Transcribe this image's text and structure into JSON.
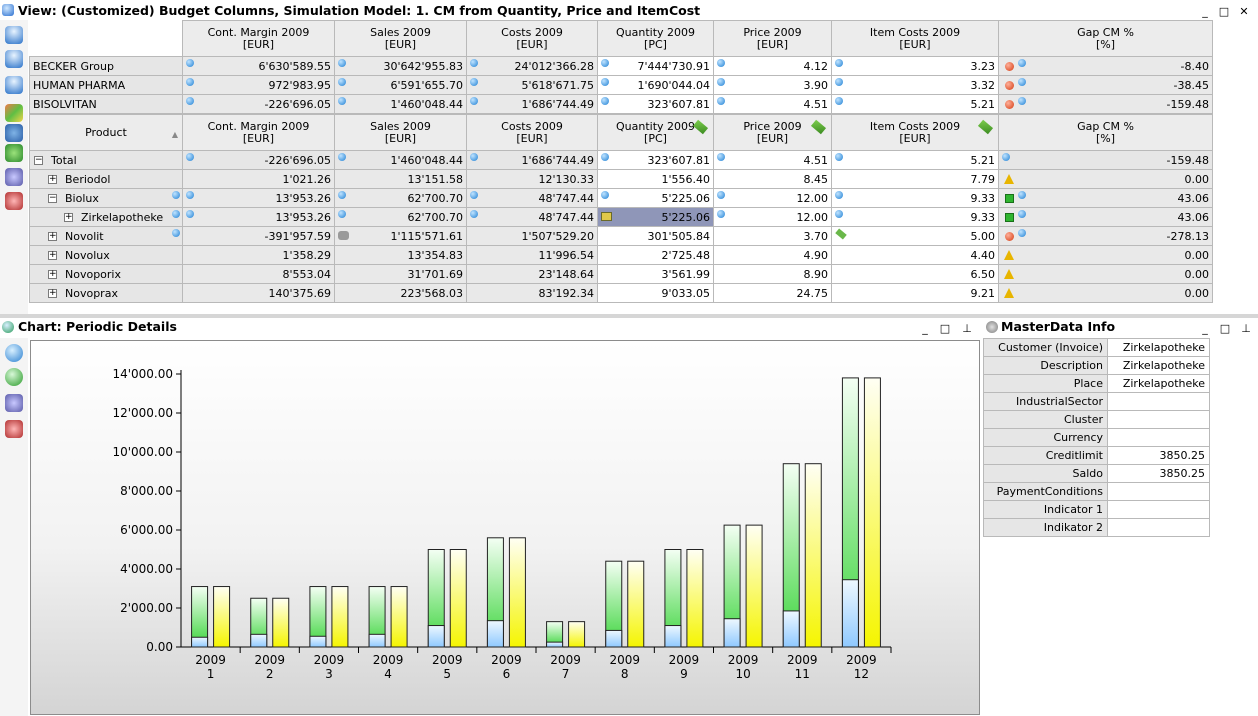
{
  "top_panel": {
    "title": "View: (Customized) Budget Columns, Simulation Model: 1. CM from Quantity, Price and ItemCost",
    "controls": [
      "_",
      "□",
      "×"
    ]
  },
  "columns": [
    {
      "name": "Cont. Margin 2009",
      "unit": "[EUR]"
    },
    {
      "name": "Sales 2009",
      "unit": "[EUR]"
    },
    {
      "name": "Costs 2009",
      "unit": "[EUR]"
    },
    {
      "name": "Quantity 2009",
      "unit": "[PC]"
    },
    {
      "name": "Price 2009",
      "unit": "[EUR]"
    },
    {
      "name": "Item Costs 2009",
      "unit": "[EUR]"
    },
    {
      "name": "Gap CM %",
      "unit": "[%]"
    }
  ],
  "customers": [
    {
      "name": "BECKER Group",
      "values": [
        "6'630'589.55",
        "30'642'955.83",
        "24'012'366.28",
        "7'444'730.91",
        "4.12",
        "3.23",
        "-8.40"
      ]
    },
    {
      "name": "HUMAN PHARMA",
      "values": [
        "972'983.95",
        "6'591'655.70",
        "5'618'671.75",
        "1'690'044.04",
        "3.90",
        "3.32",
        "-38.45"
      ]
    },
    {
      "name": "BISOLVITAN",
      "values": [
        "-226'696.05",
        "1'460'048.44",
        "1'686'744.49",
        "323'607.81",
        "4.51",
        "5.21",
        "-159.48"
      ]
    }
  ],
  "product_header": "Product",
  "products": [
    {
      "name": "Total",
      "expander": "−",
      "values": [
        "-226'696.05",
        "1'460'048.44",
        "1'686'744.49",
        "323'607.81",
        "4.51",
        "5.21",
        "-159.48"
      ]
    },
    {
      "name": "Beriodol",
      "expander": "+",
      "values": [
        "1'021.26",
        "13'151.58",
        "12'130.33",
        "1'556.40",
        "8.45",
        "7.79",
        "0.00"
      ]
    },
    {
      "name": "Biolux",
      "expander": "−",
      "values": [
        "13'953.26",
        "62'700.70",
        "48'747.44",
        "5'225.06",
        "12.00",
        "9.33",
        "43.06"
      ]
    },
    {
      "name": "Zirkelapotheke",
      "expander": "+",
      "values": [
        "13'953.26",
        "62'700.70",
        "48'747.44",
        "5'225.06",
        "12.00",
        "9.33",
        "43.06"
      ]
    },
    {
      "name": "Novolit",
      "expander": "+",
      "values": [
        "-391'957.59",
        "1'115'571.61",
        "1'507'529.20",
        "301'505.84",
        "3.70",
        "5.00",
        "-278.13"
      ]
    },
    {
      "name": "Novolux",
      "expander": "+",
      "values": [
        "1'358.29",
        "13'354.83",
        "11'996.54",
        "2'725.48",
        "4.90",
        "4.40",
        "0.00"
      ]
    },
    {
      "name": "Novoporix",
      "expander": "+",
      "values": [
        "8'553.04",
        "31'701.69",
        "23'148.64",
        "3'561.99",
        "8.90",
        "6.50",
        "0.00"
      ]
    },
    {
      "name": "Novoprax",
      "expander": "+",
      "values": [
        "140'375.69",
        "223'568.03",
        "83'192.34",
        "9'033.05",
        "24.75",
        "9.21",
        "0.00"
      ]
    }
  ],
  "chart_panel": {
    "title": "Chart: Periodic Details",
    "controls": [
      "_",
      "□",
      "×"
    ]
  },
  "masterdata_panel": {
    "title": "MasterData Info",
    "controls": [
      "_",
      "□",
      "×"
    ],
    "rows": [
      {
        "key": "Customer (Invoice)",
        "value": "Zirkelapotheke"
      },
      {
        "key": "Description",
        "value": "Zirkelapotheke"
      },
      {
        "key": "Place",
        "value": "Zirkelapotheke"
      },
      {
        "key": "IndustrialSector",
        "value": ""
      },
      {
        "key": "Cluster",
        "value": ""
      },
      {
        "key": "Currency",
        "value": ""
      },
      {
        "key": "Creditlimit",
        "value": "3850.25"
      },
      {
        "key": "Saldo",
        "value": "3850.25"
      },
      {
        "key": "PaymentConditions",
        "value": ""
      },
      {
        "key": "Indicator 1",
        "value": ""
      },
      {
        "key": "Indikator 2",
        "value": ""
      }
    ]
  },
  "chart_data": {
    "type": "bar",
    "categories": [
      "2009\n1",
      "2009\n2",
      "2009\n3",
      "2009\n4",
      "2009\n5",
      "2009\n6",
      "2009\n7",
      "2009\n8",
      "2009\n9",
      "2009\n10",
      "2009\n11",
      "2009\n12"
    ],
    "series": [
      {
        "color": "#39d439",
        "values": [
          3100,
          2500,
          3100,
          3100,
          5000,
          5600,
          1300,
          4400,
          5000,
          6250,
          9400,
          13800
        ]
      },
      {
        "color": "#8fc9ff",
        "values": [
          500,
          650,
          550,
          650,
          1100,
          1350,
          250,
          850,
          1100,
          1450,
          1850,
          3450
        ]
      },
      {
        "color": "#f5f500",
        "values": [
          3100,
          2500,
          3100,
          3100,
          5000,
          5600,
          1300,
          4400,
          5000,
          6250,
          9400,
          13800
        ]
      }
    ],
    "yticks": [
      "0.00",
      "2'000.00",
      "4'000.00",
      "6'000.00",
      "8'000.00",
      "10'000.00",
      "12'000.00",
      "14'000.00"
    ],
    "ylim": [
      0,
      14000
    ],
    "grid": false,
    "legend": "none"
  }
}
